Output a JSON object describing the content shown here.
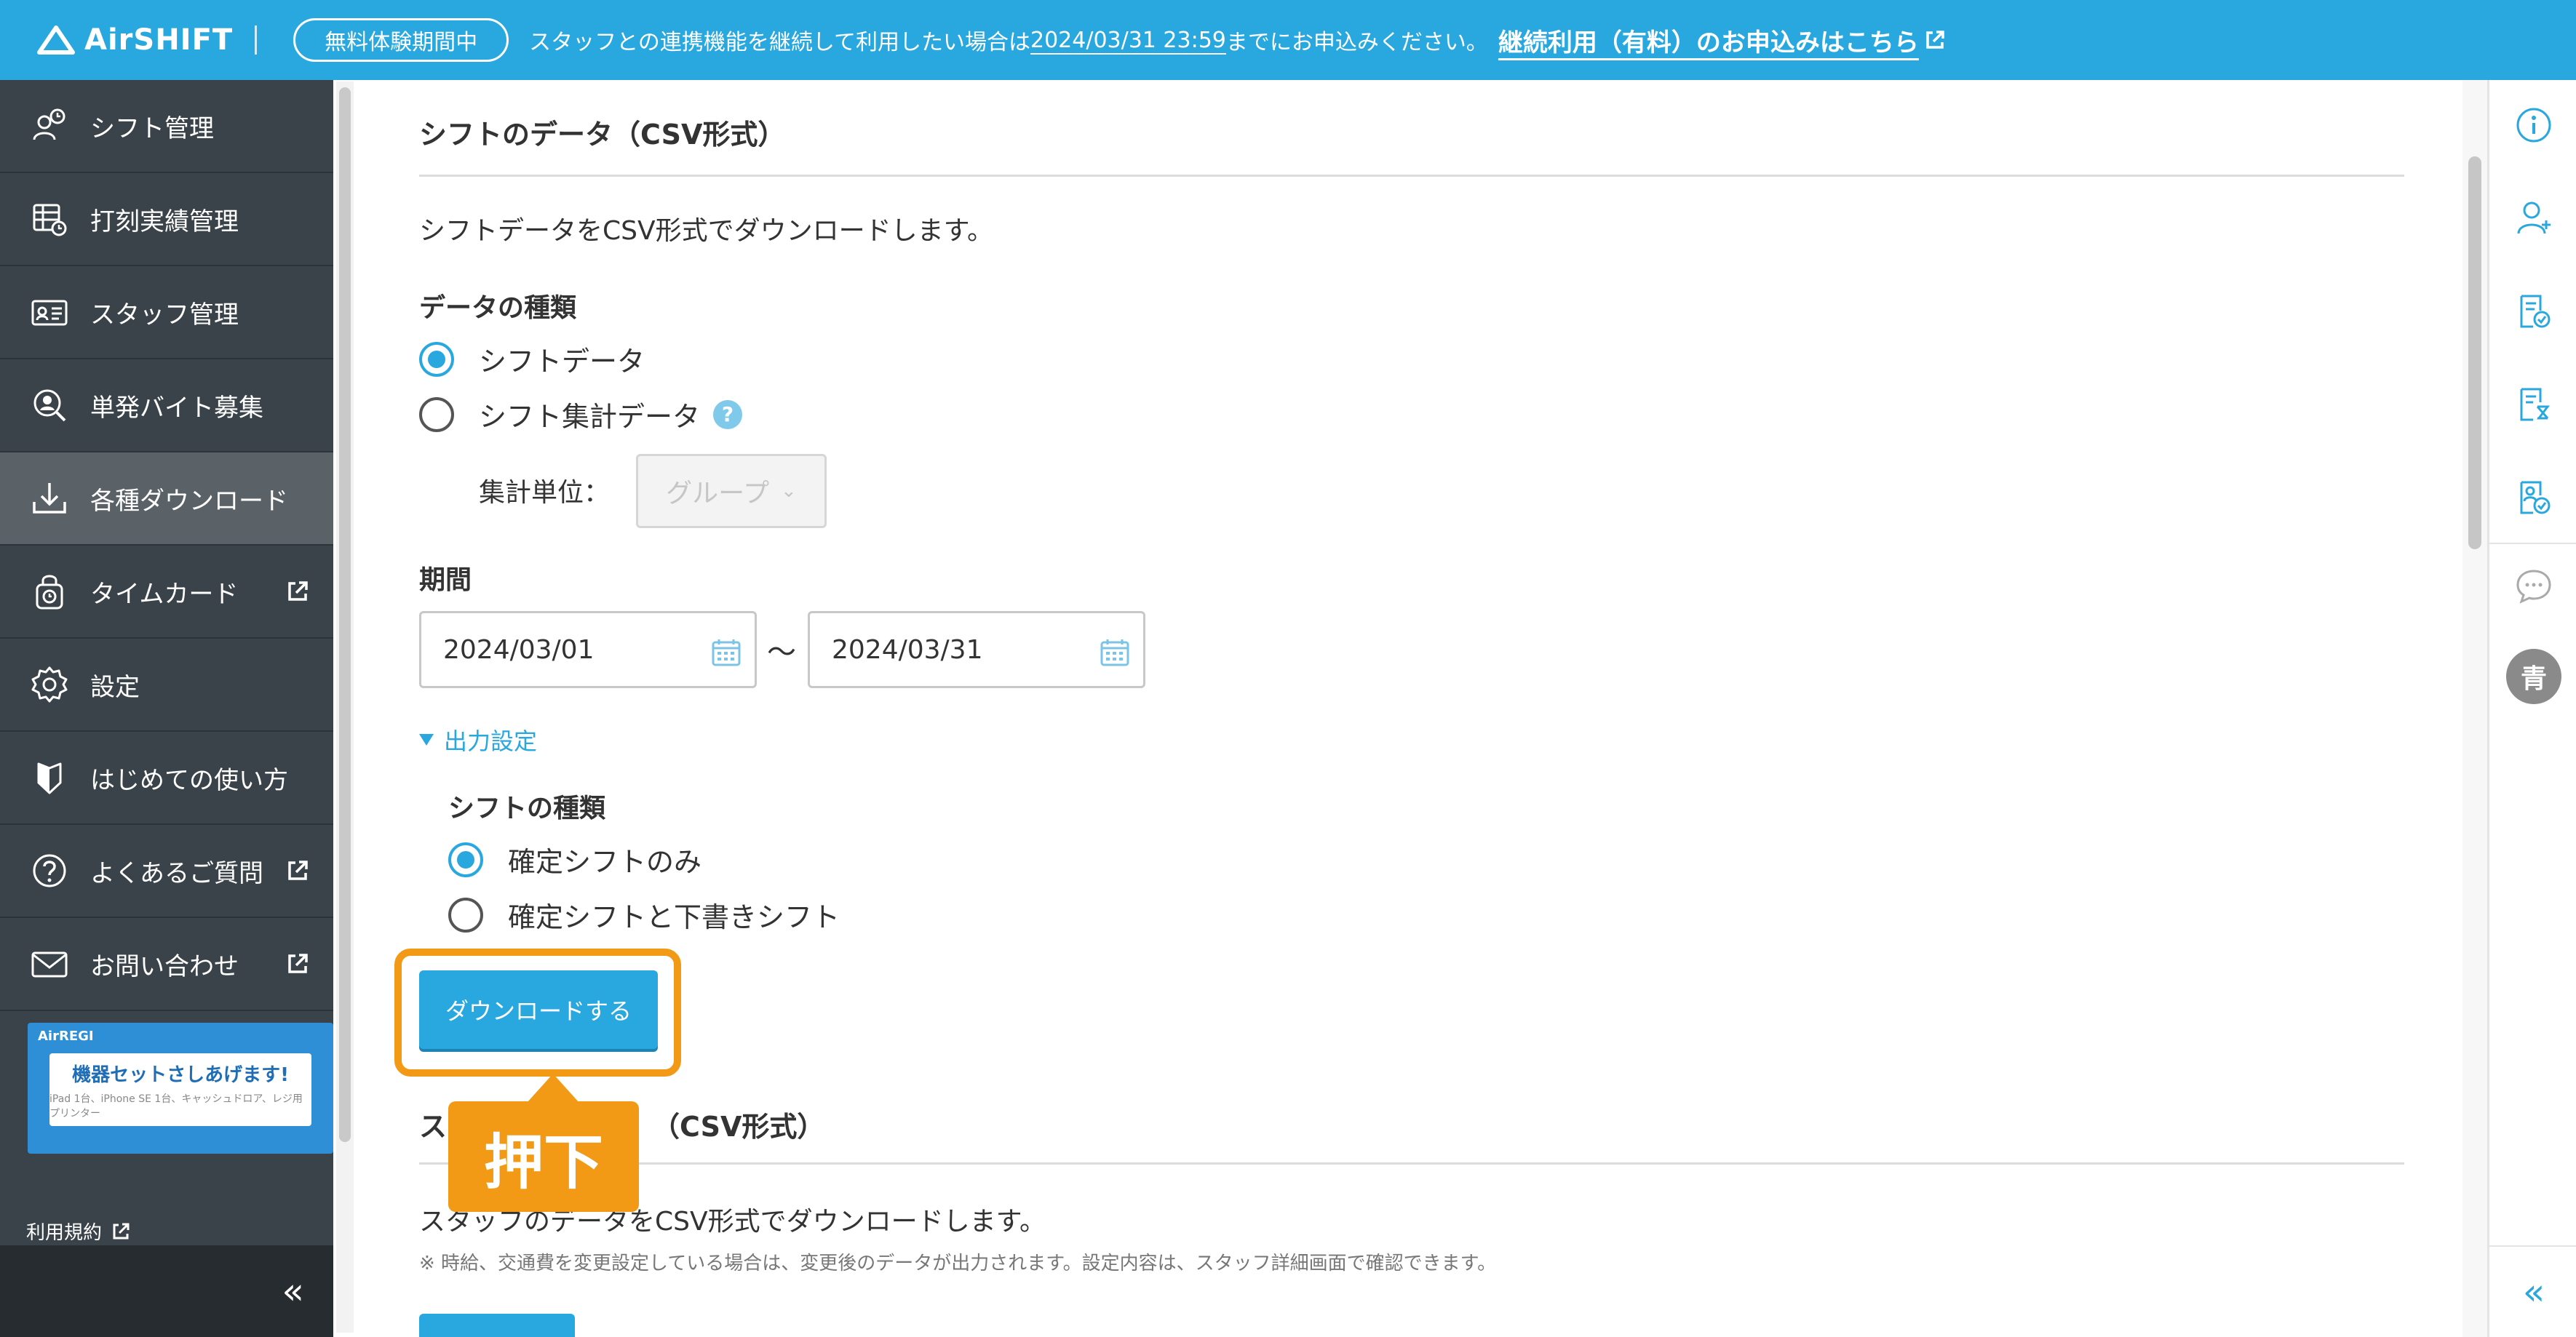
{
  "banner": {
    "brand": "AirSHIFT",
    "trial_pill": "無料体験期間中",
    "message_prefix": "スタッフとの連携機能を継続して利用したい場合は",
    "deadline": "2024/03/31 23:59",
    "message_suffix": "までにお申込みください。",
    "signup_link": "継続利用（有料）のお申込みはこちら",
    "color": "#29a8df"
  },
  "sidebar": {
    "items": [
      {
        "label": "シフト管理",
        "icon": "shift-people-icon"
      },
      {
        "label": "打刻実績管理",
        "icon": "timecard-list-icon"
      },
      {
        "label": "スタッフ管理",
        "icon": "staff-card-icon"
      },
      {
        "label": "単発バイト募集",
        "icon": "person-search-icon"
      },
      {
        "label": "各種ダウンロード",
        "icon": "download-icon"
      },
      {
        "label": "タイムカード",
        "icon": "lock-clock-icon"
      },
      {
        "label": "設定",
        "icon": "gear-icon"
      },
      {
        "label": "はじめての使い方",
        "icon": "guide-leaf-icon"
      },
      {
        "label": "よくあるご質問",
        "icon": "question-circle-icon"
      },
      {
        "label": "お問い合わせ",
        "icon": "mail-icon"
      }
    ],
    "ad": {
      "brand": "AirREGI",
      "title": "機器セットさしあげます!",
      "sub": "iPad 1台、iPhone SE 1台、キャッシュドロア、レジ用プリンター"
    },
    "terms_label": "利用規約",
    "collapse_label": "«"
  },
  "main": {
    "shift_section": {
      "title": "シフトのデータ（CSV形式）",
      "description": "シフトデータをCSV形式でダウンロードします。",
      "data_type_label": "データの種類",
      "data_type_options": [
        {
          "label": "シフトデータ",
          "selected": true
        },
        {
          "label": "シフト集計データ",
          "selected": false
        }
      ],
      "help_glyph": "?",
      "aggregate_unit_label": "集計単位：",
      "aggregate_unit_value": "グループ",
      "period_label": "期間",
      "start_date": "2024/03/01",
      "range_separator": "〜",
      "end_date": "2024/03/31",
      "output_settings_toggle": "出力設定",
      "shift_kind_label": "シフトの種類",
      "shift_kind_options": [
        {
          "label": "確定シフトのみ",
          "selected": true
        },
        {
          "label": "確定シフトと下書きシフト",
          "selected": false
        }
      ],
      "download_button": "ダウンロードする"
    },
    "staff_section": {
      "title_visible_start": "ス",
      "title_visible_end": "（CSV形式）",
      "description": "スタッフのデータをCSV形式でダウンロードします。",
      "note": "※ 時給、交通費を変更設定している場合は、変更後のデータが出力されます。設定内容は、スタッフ詳細画面で確認できます。"
    },
    "callout": "押下",
    "highlight_color": "#f29a16"
  },
  "rail": {
    "avatar_initial": "青",
    "collapse_label": "«"
  }
}
